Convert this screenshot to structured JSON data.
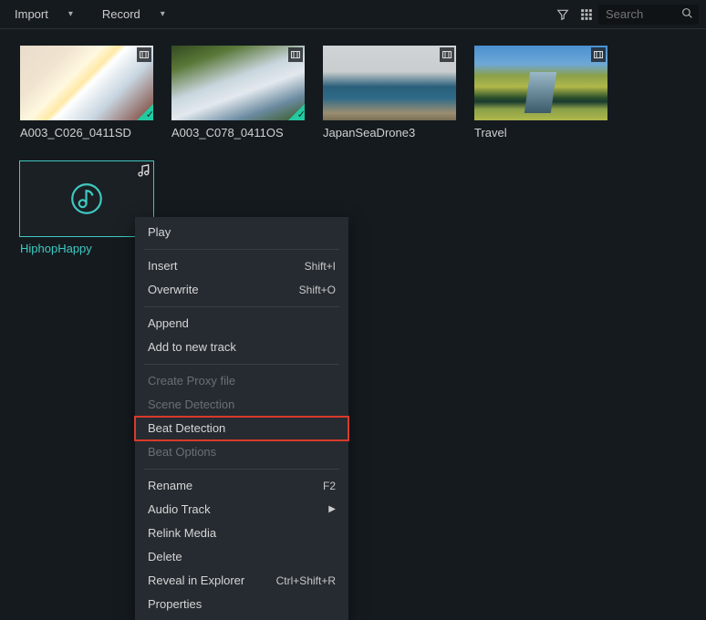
{
  "toolbar": {
    "import_label": "Import",
    "record_label": "Record",
    "search_placeholder": "Search"
  },
  "media": [
    {
      "label": "A003_C026_0411SD",
      "kind": "video",
      "checked": true
    },
    {
      "label": "A003_C078_0411OS",
      "kind": "video",
      "checked": true
    },
    {
      "label": "JapanSeaDrone3",
      "kind": "video",
      "checked": false
    },
    {
      "label": "Travel",
      "kind": "video",
      "checked": false
    },
    {
      "label": "HiphopHappy",
      "kind": "audio",
      "checked": false,
      "selected": true
    }
  ],
  "context_menu": {
    "groups": [
      [
        {
          "label": "Play",
          "shortcut": ""
        }
      ],
      [
        {
          "label": "Insert",
          "shortcut": "Shift+I"
        },
        {
          "label": "Overwrite",
          "shortcut": "Shift+O"
        }
      ],
      [
        {
          "label": "Append",
          "shortcut": ""
        },
        {
          "label": "Add to new track",
          "shortcut": ""
        }
      ],
      [
        {
          "label": "Create Proxy file",
          "disabled": true
        },
        {
          "label": "Scene Detection",
          "disabled": true
        },
        {
          "label": "Beat Detection",
          "highlight": true
        },
        {
          "label": "Beat Options",
          "disabled": true
        }
      ],
      [
        {
          "label": "Rename",
          "shortcut": "F2"
        },
        {
          "label": "Audio Track",
          "submenu": true
        },
        {
          "label": "Relink Media"
        },
        {
          "label": "Delete"
        },
        {
          "label": "Reveal in Explorer",
          "shortcut": "Ctrl+Shift+R"
        },
        {
          "label": "Properties"
        }
      ]
    ]
  }
}
